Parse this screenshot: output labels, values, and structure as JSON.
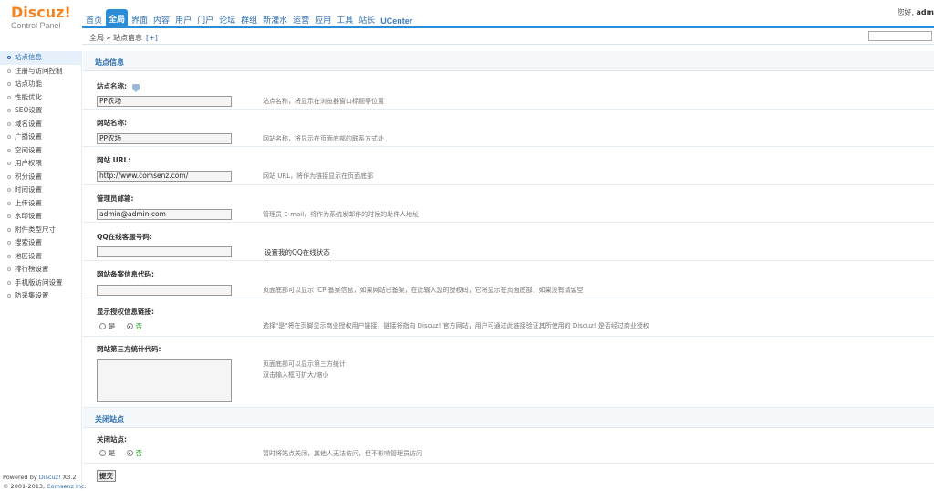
{
  "logo": {
    "main": "Discuz",
    "exclaim": "!",
    "sub": "Control Panel"
  },
  "topnav": [
    {
      "label": "首页",
      "active": false
    },
    {
      "label": "全局",
      "active": true
    },
    {
      "label": "界面",
      "active": false
    },
    {
      "label": "内容",
      "active": false
    },
    {
      "label": "用户",
      "active": false
    },
    {
      "label": "门户",
      "active": false
    },
    {
      "label": "论坛",
      "active": false
    },
    {
      "label": "群组",
      "active": false
    },
    {
      "label": "新灌水",
      "active": false
    },
    {
      "label": "运营",
      "active": false
    },
    {
      "label": "应用",
      "active": false
    },
    {
      "label": "工具",
      "active": false
    },
    {
      "label": "站长",
      "active": false
    },
    {
      "label": "UCenter",
      "active": false
    }
  ],
  "greeting": {
    "prefix": "您好,",
    "user": "adm"
  },
  "breadcrumb": {
    "text": "全局 » 站点信息",
    "plus": "[+]"
  },
  "sidebar": {
    "items": [
      "站点信息",
      "注册与访问控制",
      "站点功能",
      "性能优化",
      "SEO设置",
      "域名设置",
      "广播设置",
      "空间设置",
      "用户权限",
      "积分设置",
      "时间设置",
      "上传设置",
      "水印设置",
      "附件类型尺寸",
      "搜索设置",
      "地区设置",
      "排行榜设置",
      "手机版访问设置",
      "防采集设置"
    ],
    "active_index": 0
  },
  "footer": {
    "powered_prefix": "Powered by ",
    "powered_brand": "Discuz!",
    "version": " X3.2",
    "copyright_prefix": "© 2001-2013, ",
    "copyright_brand": "Comsenz Inc."
  },
  "main": {
    "section1_title": "站点信息",
    "site_name": {
      "label": "站点名称:",
      "value": "PP农场",
      "hint": "站点名称，将显示在浏览器窗口标题等位置"
    },
    "web_name": {
      "label": "网站名称:",
      "value": "PP农场",
      "hint": "网站名称，将显示在页面底部的联系方式处"
    },
    "web_url": {
      "label": "网站 URL:",
      "value": "http://www.comsenz.com/",
      "hint": "网站 URL，将作为链接显示在页面底部"
    },
    "admin_email": {
      "label": "管理员邮箱:",
      "value": "admin@admin.com",
      "hint": "管理员 E-mail，将作为系统发邮件的时候的发件人地址"
    },
    "qq": {
      "label": "QQ在线客服号码:",
      "value": "",
      "link": "设置我的QQ在线状态"
    },
    "icp": {
      "label": "网站备案信息代码:",
      "value": "",
      "hint": "页面底部可以显示 ICP 备案信息，如果网站已备案，在此输入您的授权码，它将显示在页面底部，如果没有请留空"
    },
    "license": {
      "label": "显示授权信息链接:",
      "yes": "是",
      "no": "否",
      "selected": "no",
      "hint": "选择\"是\"将在页脚显示商业授权用户链接，链接将指向 Discuz! 官方网站，用户可通过此链接验证其所使用的 Discuz! 是否经过商业授权"
    },
    "stats": {
      "label": "网站第三方统计代码:",
      "hint1": "页面底部可以显示第三方统计",
      "hint2": "双击输入框可扩大/缩小"
    },
    "section2_title": "关闭站点",
    "close": {
      "label": "关闭站点:",
      "yes": "是",
      "no": "否",
      "selected": "no",
      "hint": "暂时将站点关闭，其他人无法访问，但不影响管理员访问"
    },
    "submit_label": "提交"
  },
  "colors": {
    "accent": "#2a8bd6",
    "logo": "#f58220",
    "link": "#2b6cb0",
    "green": "#1ea11e"
  }
}
